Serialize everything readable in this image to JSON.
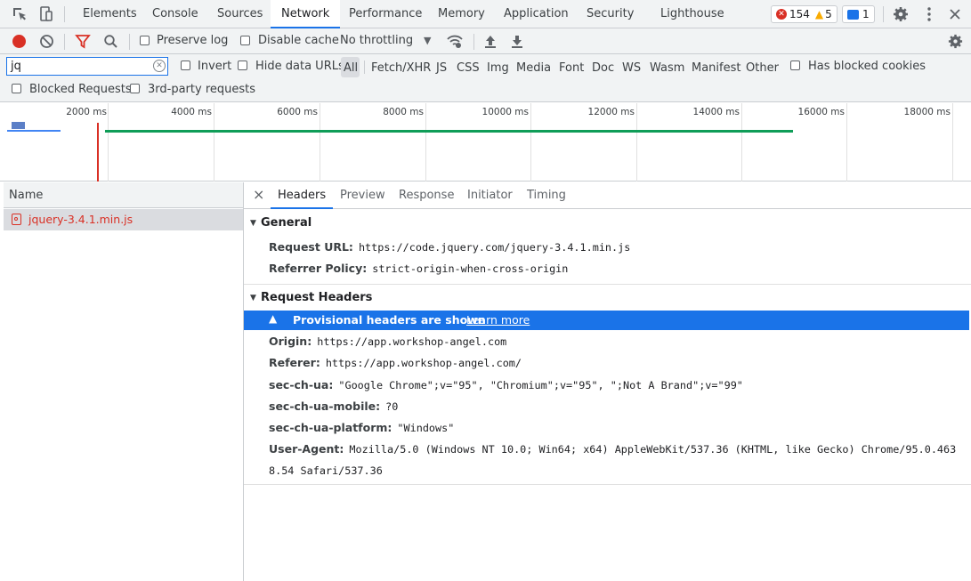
{
  "tabs": {
    "items": [
      "Elements",
      "Console",
      "Sources",
      "Network",
      "Performance",
      "Memory",
      "Application",
      "Security",
      "Lighthouse"
    ],
    "active": "Network"
  },
  "badges": {
    "errors": "154",
    "warnings": "5",
    "messages": "1"
  },
  "toolbar": {
    "preserve_log": "Preserve log",
    "disable_cache": "Disable cache",
    "throttling": "No throttling"
  },
  "filter": {
    "value": "jq",
    "invert": "Invert",
    "hide_data_urls": "Hide data URLs",
    "types": [
      "All",
      "Fetch/XHR",
      "JS",
      "CSS",
      "Img",
      "Media",
      "Font",
      "Doc",
      "WS",
      "Wasm",
      "Manifest",
      "Other"
    ],
    "has_blocked_cookies": "Has blocked cookies",
    "blocked_requests": "Blocked Requests",
    "third_party": "3rd-party requests"
  },
  "overview": {
    "ticks": [
      "2000 ms",
      "4000 ms",
      "6000 ms",
      "8000 ms",
      "10000 ms",
      "12000 ms",
      "14000 ms",
      "16000 ms",
      "18000 ms"
    ]
  },
  "requests": {
    "column_name": "Name",
    "items": [
      {
        "name": "jquery-3.4.1.min.js",
        "status": "error"
      }
    ]
  },
  "details": {
    "close": "×",
    "tabs": [
      "Headers",
      "Preview",
      "Response",
      "Initiator",
      "Timing"
    ],
    "active_tab": "Headers",
    "general": {
      "title": "General",
      "request_url_label": "Request URL:",
      "request_url": "https://code.jquery.com/jquery-3.4.1.min.js",
      "referrer_policy_label": "Referrer Policy:",
      "referrer_policy": "strict-origin-when-cross-origin"
    },
    "request_headers": {
      "title": "Request Headers",
      "warning": "Provisional headers are shown",
      "learn_more": "Learn more",
      "rows": [
        {
          "key": "Origin:",
          "value": "https://app.workshop-angel.com"
        },
        {
          "key": "Referer:",
          "value": "https://app.workshop-angel.com/"
        },
        {
          "key": "sec-ch-ua:",
          "value": "\"Google Chrome\";v=\"95\", \"Chromium\";v=\"95\", \";Not A Brand\";v=\"99\""
        },
        {
          "key": "sec-ch-ua-mobile:",
          "value": "?0"
        },
        {
          "key": "sec-ch-ua-platform:",
          "value": "\"Windows\""
        },
        {
          "key": "User-Agent:",
          "value": "Mozilla/5.0 (Windows NT 10.0; Win64; x64) AppleWebKit/537.36 (KHTML, like Gecko) Chrome/95.0.463",
          "value2": "8.54 Safari/537.36"
        }
      ]
    }
  },
  "colors": {
    "accent": "#1a73e8",
    "error": "#d93025",
    "warning": "#f9ab00",
    "waterfall_green": "#0f9d58",
    "waterfall_blue": "#4285f4",
    "red_marker": "#d93025"
  }
}
